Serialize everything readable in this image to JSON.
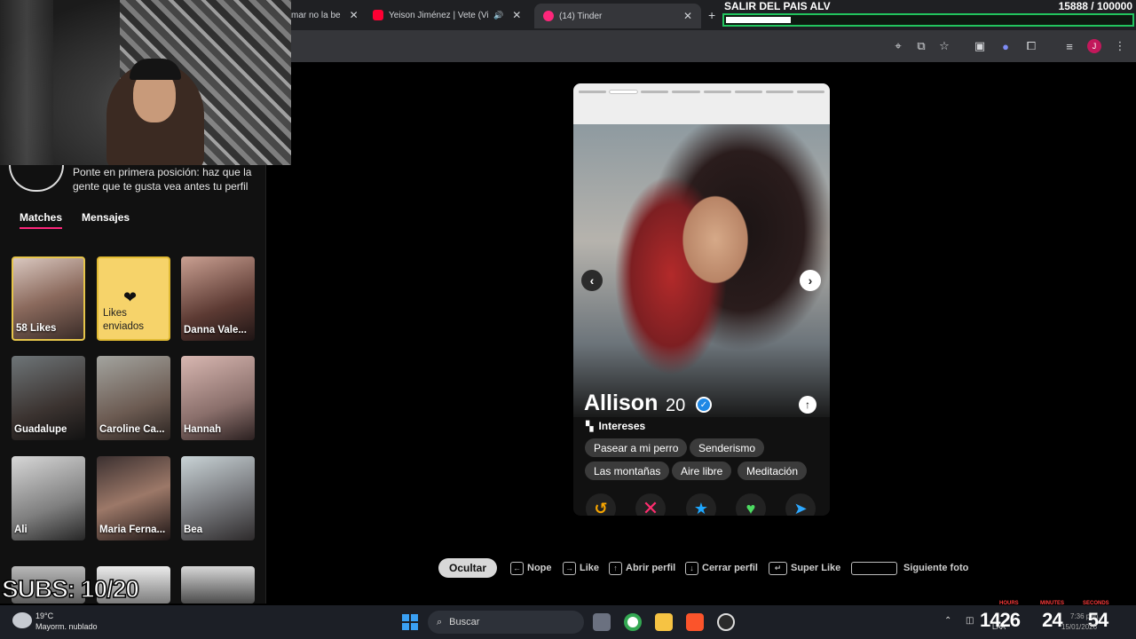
{
  "browser": {
    "tabs": [
      {
        "label": "mar no la be"
      },
      {
        "label": "Yeison Jiménez | Vete (Vide"
      },
      {
        "label": "(14) Tinder",
        "active": true
      }
    ],
    "new_tab": "+",
    "toolbar_icons": [
      "location-icon",
      "cast-icon",
      "star-icon",
      "extension-icon",
      "puzzle-icon",
      "media-icon",
      "profile-avatar",
      "menu-icon"
    ],
    "profile_initial": "J"
  },
  "goal": {
    "title": "SALIR DEL PAIS ALV",
    "count": "15888",
    "target": "/ 100000",
    "progress": 0.159
  },
  "sidebar": {
    "boost_text": "Ponte en primera posición: haz que la gente que te gusta vea antes tu perfil",
    "tabs": {
      "matches": "Matches",
      "messages": "Mensajes"
    },
    "cards": [
      {
        "name": "58 Likes",
        "type": "likes"
      },
      {
        "name": "Likes enviados",
        "type": "sent"
      },
      {
        "name": "Danna Vale..."
      },
      {
        "name": "Guadalupe"
      },
      {
        "name": "Caroline Ca..."
      },
      {
        "name": "Hannah"
      },
      {
        "name": "Ali"
      },
      {
        "name": "Maria Ferna..."
      },
      {
        "name": "Bea"
      }
    ]
  },
  "overlay": {
    "subs": "SUBS: 10/20"
  },
  "profile": {
    "name": "Allison",
    "age": "20",
    "photo_index": 2,
    "photo_count": 8,
    "interests_label": "Intereses",
    "interests": [
      "Pasear a mi perro",
      "Senderismo",
      "Las montañas",
      "Aire libre",
      "Meditación"
    ],
    "actions": [
      "rewind-icon",
      "nope-icon",
      "super-like-icon",
      "like-icon",
      "boost-icon"
    ]
  },
  "hints": {
    "hide": "Ocultar",
    "nope": "Nope",
    "like": "Like",
    "open_profile": "Abrir perfil",
    "close_profile": "Cerrar perfil",
    "super_like": "Super Like",
    "next_photo": "Siguiente foto"
  },
  "taskbar": {
    "temp": "19°C",
    "weather": "Mayorm. nublado",
    "search": "Buscar",
    "clock_hours": "14",
    "clock_minutes": "26",
    "clock_seconds": "24",
    "clock_extra": "54",
    "clock_labels": [
      "HOURS",
      "MINUTES",
      "SECONDS"
    ],
    "time_small": "7:36 p.m.",
    "date": "15/01/2026",
    "lang": "LAA"
  },
  "colors": {
    "accent": "#fd267a",
    "goal_border": "#22c55e",
    "likes_gold": "#e6c54a"
  }
}
